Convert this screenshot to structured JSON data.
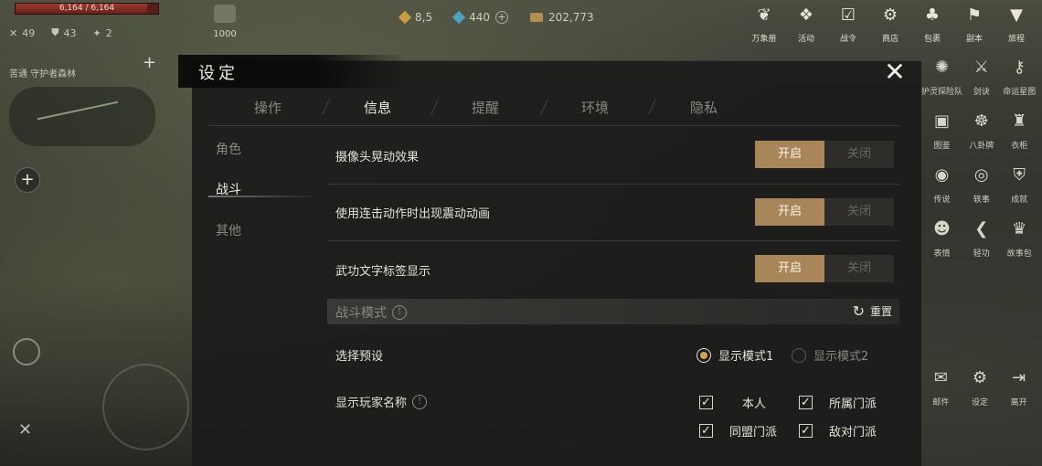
{
  "hud": {
    "hp": "6,164 / 6,164",
    "stats": [
      "49",
      "43",
      "2"
    ],
    "level": "1000",
    "currency": {
      "jade": "8,5",
      "gems": "440",
      "silver": "202,773"
    },
    "map_title": "苦通 守护者森林"
  },
  "top_icons": [
    "万象册",
    "活动",
    "战令",
    "商店",
    "包裹",
    "副本",
    "旅程"
  ],
  "side_icons": [
    "护灵探险队",
    "剑诀",
    "命运星图",
    "图鉴",
    "八卦牌",
    "衣柜",
    "传说",
    "轶事",
    "成就",
    "表情",
    "轻功",
    "故事包"
  ],
  "bottom_icons": [
    "邮件",
    "设定",
    "离开"
  ],
  "settings": {
    "title": "设定",
    "tabs": [
      "操作",
      "信息",
      "提醒",
      "环境",
      "隐私"
    ],
    "active_tab": "信息",
    "categories": [
      "角色",
      "战斗",
      "其他"
    ],
    "active_category": "战斗",
    "on_label": "开启",
    "off_label": "关闭",
    "options": [
      {
        "label": "摄像头晃动效果",
        "state": "on"
      },
      {
        "label": "使用连击动作时出现震动动画",
        "state": "on"
      },
      {
        "label": "武功文字标签显示",
        "state": "on"
      }
    ],
    "battle_mode": {
      "label": "战斗模式",
      "reset": "重置"
    },
    "preset": {
      "label": "选择预设",
      "options": [
        "显示模式1",
        "显示模式2"
      ],
      "selected": 0
    },
    "player_names": {
      "label": "显示玩家名称",
      "checks": [
        {
          "label": "本人",
          "checked": true
        },
        {
          "label": "所属门派",
          "checked": true
        },
        {
          "label": "同盟门派",
          "checked": true
        },
        {
          "label": "敌对门派",
          "checked": true
        }
      ]
    }
  }
}
